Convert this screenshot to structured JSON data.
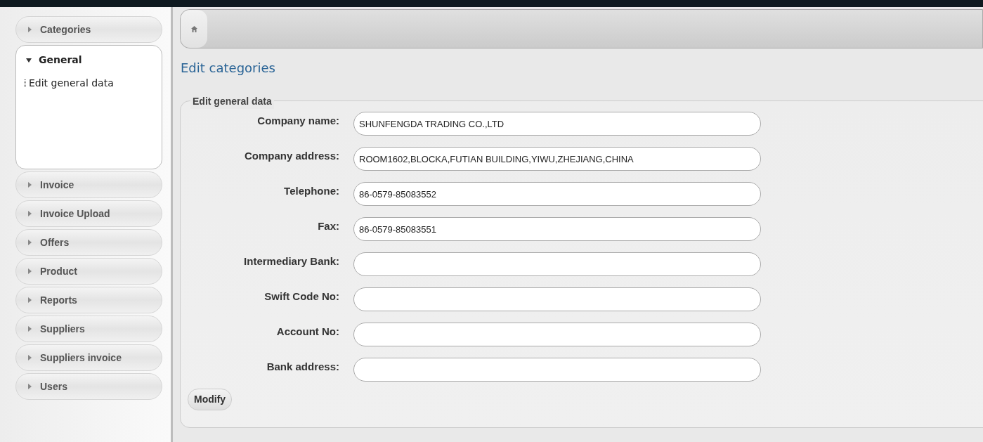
{
  "sidebar": {
    "items": [
      {
        "label": "Categories",
        "expanded": false
      },
      {
        "label": "General",
        "expanded": true,
        "children": [
          {
            "label": "Edit general data"
          }
        ]
      },
      {
        "label": "Invoice",
        "expanded": false
      },
      {
        "label": "Invoice Upload",
        "expanded": false
      },
      {
        "label": "Offers",
        "expanded": false
      },
      {
        "label": "Product",
        "expanded": false
      },
      {
        "label": "Reports",
        "expanded": false
      },
      {
        "label": "Suppliers",
        "expanded": false
      },
      {
        "label": "Suppliers invoice",
        "expanded": false
      },
      {
        "label": "Users",
        "expanded": false
      }
    ]
  },
  "page_title": "Edit categories",
  "form": {
    "legend": "Edit general data",
    "fields": [
      {
        "label": "Company name:",
        "value": "SHUNFENGDA TRADING CO.,LTD"
      },
      {
        "label": "Company address:",
        "value": "ROOM1602,BLOCKA,FUTIAN BUILDING,YIWU,ZHEJIANG,CHINA"
      },
      {
        "label": "Telephone:",
        "value": "86-0579-85083552"
      },
      {
        "label": "Fax:",
        "value": "86-0579-85083551"
      },
      {
        "label": "Intermediary Bank:"
      },
      {
        "label": "Swift Code No:"
      },
      {
        "label": "Account No:"
      },
      {
        "label": "Bank address:"
      }
    ],
    "submit": "Modify"
  }
}
